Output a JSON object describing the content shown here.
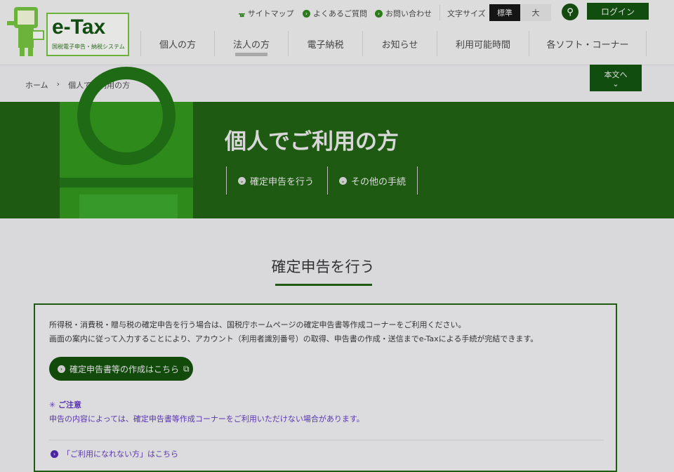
{
  "logo": {
    "text": "e-Tax",
    "subtitle": "国税電子申告・納税システム"
  },
  "top_links": [
    {
      "label": "サイトマップ",
      "icon": "sitemap-icon"
    },
    {
      "label": "よくあるご質問",
      "icon": "chevron-right-icon"
    },
    {
      "label": "お問い合わせ",
      "icon": "chevron-right-icon"
    }
  ],
  "font_size": {
    "label": "文字サイズ",
    "options": [
      "標準",
      "大"
    ],
    "selected": "標準"
  },
  "login_label": "ログイン",
  "nav": [
    "個人の方",
    "法人の方",
    "電子納税",
    "お知らせ",
    "利用可能時間",
    "各ソフト・コーナー"
  ],
  "breadcrumb": {
    "home": "ホーム",
    "current": "個人でご利用の方"
  },
  "skip_label": "本文へ",
  "hero": {
    "title": "個人でご利用の方",
    "links": [
      "確定申告を行う",
      "その他の手続"
    ]
  },
  "section": {
    "title": "確定申告を行う",
    "para1": "所得税・消費税・贈与税の確定申告を行う場合は、国税庁ホームページの確定申告書等作成コーナーをご利用ください。",
    "para2": "画面の案内に従って入力することにより、アカウント（利用者識別番号）の取得、申告書の作成・送信までe-Taxによる手続が完結できます。",
    "cta": "確定申告書等の作成はこちら",
    "notice_title": "ご注意",
    "notice_text": "申告の内容によっては、確定申告書等作成コーナーをご利用いただけない場合があります。",
    "unavailable_link": "「ご利用になれない方」はこちら"
  },
  "colors": {
    "brand": "#1e5a12",
    "link": "#5a35b0"
  }
}
